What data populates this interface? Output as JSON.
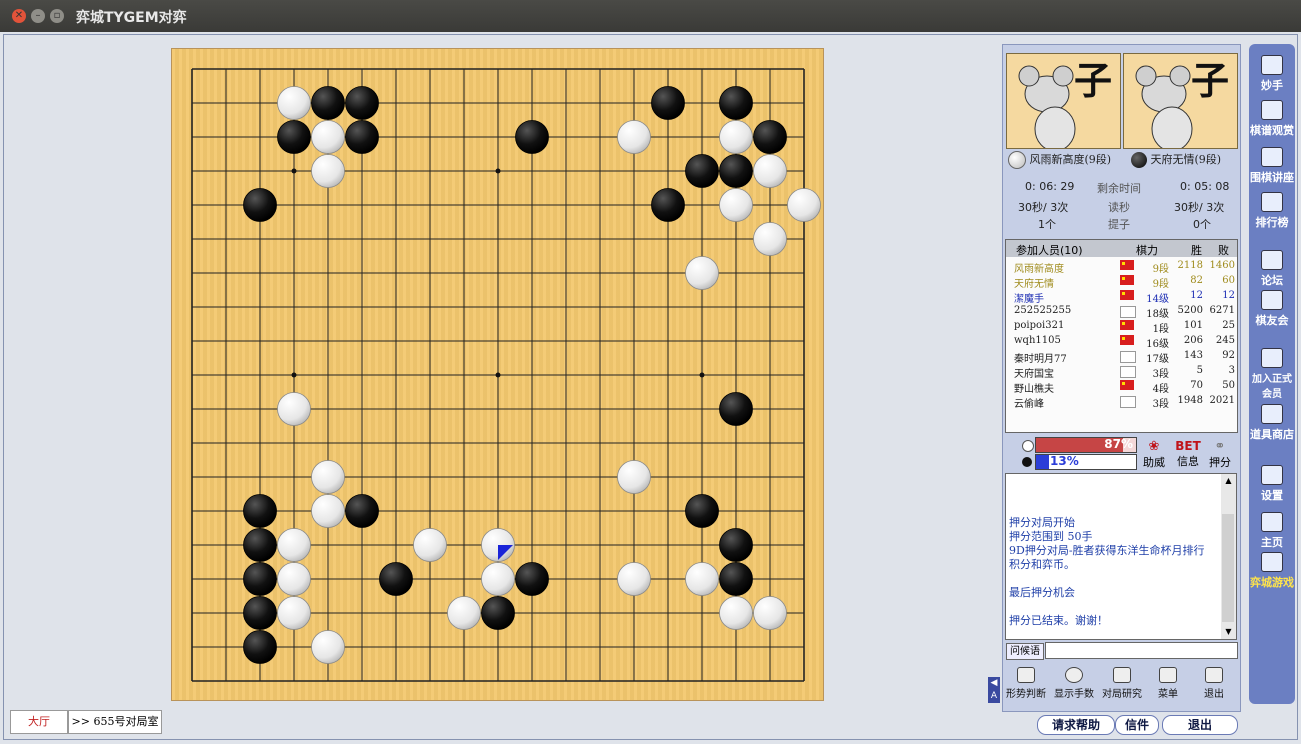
{
  "window": {
    "title": "弈城TYGEM对弈"
  },
  "players": {
    "white": {
      "name": "风雨新高度(9段)",
      "avatar_char": "子"
    },
    "black": {
      "name": "天府无情(9段)",
      "avatar_char": "子"
    }
  },
  "clock": {
    "white_time": "0: 06: 29",
    "black_time": "0: 05: 08",
    "remaining_label": "剩余时间",
    "white_byoyomi": "30秒/ 3次",
    "black_byoyomi": "30秒/ 3次",
    "byoyomi_label": "读秒",
    "white_captures": "1个",
    "black_captures": "0个",
    "captures_label": "提子"
  },
  "participants": {
    "header": {
      "name": "参加人员(10)",
      "rank": "棋力",
      "wins": "胜",
      "losses": "败"
    },
    "rows": [
      {
        "name": "风雨新高度",
        "rank": "9段",
        "wins": "2118",
        "losses": "1460",
        "color": "#a08c1e",
        "flag": true
      },
      {
        "name": "天府无情",
        "rank": "9段",
        "wins": "82",
        "losses": "60",
        "color": "#a08c1e",
        "flag": true
      },
      {
        "name": "潔魔手",
        "rank": "14级",
        "wins": "12",
        "losses": "12",
        "color": "#1e2fb4",
        "flag": true
      },
      {
        "name": "252525255",
        "rank": "18级",
        "wins": "5200",
        "losses": "6271",
        "color": "#222222",
        "flag": false
      },
      {
        "name": "poipoi321",
        "rank": "1段",
        "wins": "101",
        "losses": "25",
        "color": "#222222",
        "flag": true
      },
      {
        "name": "wqh1105",
        "rank": "16级",
        "wins": "206",
        "losses": "245",
        "color": "#222222",
        "flag": true
      },
      {
        "name": "秦时明月77",
        "rank": "17级",
        "wins": "143",
        "losses": "92",
        "color": "#222222",
        "flag": false
      },
      {
        "name": "天府国宝",
        "rank": "3段",
        "wins": "5",
        "losses": "3",
        "color": "#222222",
        "flag": false
      },
      {
        "name": "野山樵夫",
        "rank": "4段",
        "wins": "70",
        "losses": "50",
        "color": "#222222",
        "flag": true
      },
      {
        "name": "云偷峰",
        "rank": "3段",
        "wins": "1948",
        "losses": "2021",
        "color": "#222222",
        "flag": false
      }
    ]
  },
  "betting": {
    "white_pct_label": "87%",
    "black_pct_label": "13%",
    "white_pct": 87,
    "black_pct": 13,
    "cheer_label": "助威",
    "info_label": "信息",
    "score_label": "押分",
    "bet_logo": "BET"
  },
  "chat": {
    "lines": [
      "押分对局开始",
      "押分范围到 50手",
      "9D押分对局-胜者获得东洋生命杯月排行",
      "积分和弈币。",
      "",
      "最后押分机会",
      "",
      "押分已结束。谢谢！"
    ],
    "input_label": "问候语",
    "input_value": ""
  },
  "toolbar": [
    "形势判断",
    "显示手数",
    "对局研究",
    "菜单",
    "退出"
  ],
  "right_nav": [
    "妙手",
    "棋谱观赏",
    "围棋讲座",
    "排行榜",
    "论坛",
    "棋友会",
    "加入正式会员",
    "道具商店",
    "设置",
    "主页",
    "弈城游戏"
  ],
  "bottom": {
    "help": "请求帮助",
    "mail": "信件",
    "exit": "退出",
    "tab_lobby": "大厅",
    "tab_room": ">> 655号对局室"
  },
  "board": {
    "size": 19,
    "black": [
      [
        4,
        1
      ],
      [
        5,
        1
      ],
      [
        14,
        1
      ],
      [
        16,
        1
      ],
      [
        3,
        2
      ],
      [
        5,
        2
      ],
      [
        10,
        2
      ],
      [
        17,
        2
      ],
      [
        15,
        3
      ],
      [
        16,
        3
      ],
      [
        2,
        4
      ],
      [
        14,
        4
      ],
      [
        16,
        10
      ],
      [
        2,
        13
      ],
      [
        5,
        13
      ],
      [
        15,
        13
      ],
      [
        2,
        14
      ],
      [
        16,
        14
      ],
      [
        2,
        15
      ],
      [
        6,
        15
      ],
      [
        10,
        15
      ],
      [
        16,
        15
      ],
      [
        2,
        16
      ],
      [
        9,
        16
      ],
      [
        2,
        17
      ]
    ],
    "white": [
      [
        3,
        1
      ],
      [
        4,
        2
      ],
      [
        13,
        2
      ],
      [
        16,
        2
      ],
      [
        4,
        3
      ],
      [
        17,
        3
      ],
      [
        16,
        4
      ],
      [
        18,
        4
      ],
      [
        17,
        5
      ],
      [
        15,
        6
      ],
      [
        3,
        10
      ],
      [
        4,
        12
      ],
      [
        13,
        12
      ],
      [
        4,
        13
      ],
      [
        3,
        14
      ],
      [
        7,
        14
      ],
      [
        9,
        14
      ],
      [
        3,
        15
      ],
      [
        9,
        15
      ],
      [
        13,
        15
      ],
      [
        15,
        15
      ],
      [
        3,
        16
      ],
      [
        8,
        16
      ],
      [
        16,
        16
      ],
      [
        17,
        16
      ],
      [
        4,
        17
      ]
    ],
    "last_move": [
      9,
      14
    ],
    "hoshi": [
      [
        3,
        3
      ],
      [
        9,
        3
      ],
      [
        15,
        3
      ],
      [
        3,
        9
      ],
      [
        9,
        9
      ],
      [
        15,
        9
      ],
      [
        3,
        15
      ],
      [
        9,
        15
      ],
      [
        15,
        15
      ]
    ]
  }
}
